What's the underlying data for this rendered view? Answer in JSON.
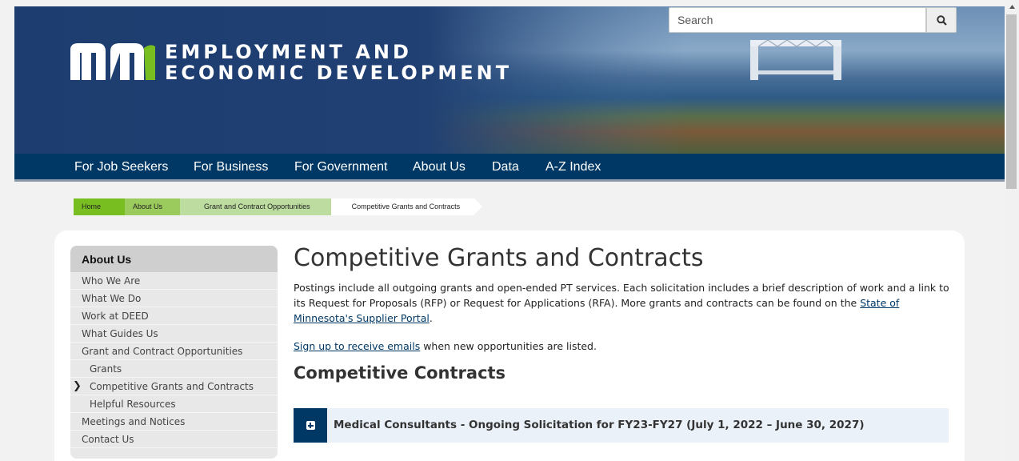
{
  "header": {
    "logo_icon": "mn-logo-icon",
    "logo_line1": "EMPLOYMENT AND",
    "logo_line2": "ECONOMIC DEVELOPMENT"
  },
  "search": {
    "placeholder": "Search",
    "icon": "search-icon"
  },
  "nav": {
    "items": [
      "For Job Seekers",
      "For Business",
      "For Government",
      "About Us",
      "Data",
      "A-Z Index"
    ]
  },
  "breadcrumb": [
    "Home",
    "About Us",
    "Grant and Contract Opportunities",
    "Competitive Grants and Contracts"
  ],
  "sidebar": {
    "title": "About Us",
    "links": [
      "Who We Are",
      "What We Do",
      "Work at DEED",
      "What Guides Us",
      "Grant and Contract Opportunities",
      "Grants",
      "Competitive Grants and Contracts",
      "Helpful Resources",
      "Meetings and Notices",
      "Contact Us"
    ],
    "active_icon": "chevron-right-icon"
  },
  "main": {
    "title": "Competitive Grants and Contracts",
    "intro_text": "Postings include all outgoing grants and open-ended PT services. Each solicitation includes a brief description of work and a link to its Request for Proposals (RFP) or Request for Applications (RFA). More grants and contracts can be found on the ",
    "intro_link": "State of Minnesota's Supplier Portal",
    "intro_end": ".",
    "signup_link": "Sign up to receive emails",
    "signup_text": " when new opportunities are listed.",
    "section_title": "Competitive Contracts",
    "accordion_label": "Medical Consultants - Ongoing Solicitation for FY23-FY27 (July 1, 2022 – June 30, 2027)",
    "accordion_icon": "plus-square-icon"
  },
  "colors": {
    "navy": "#003865",
    "green": "#78be20",
    "banner_blue": "#1d3d70"
  }
}
